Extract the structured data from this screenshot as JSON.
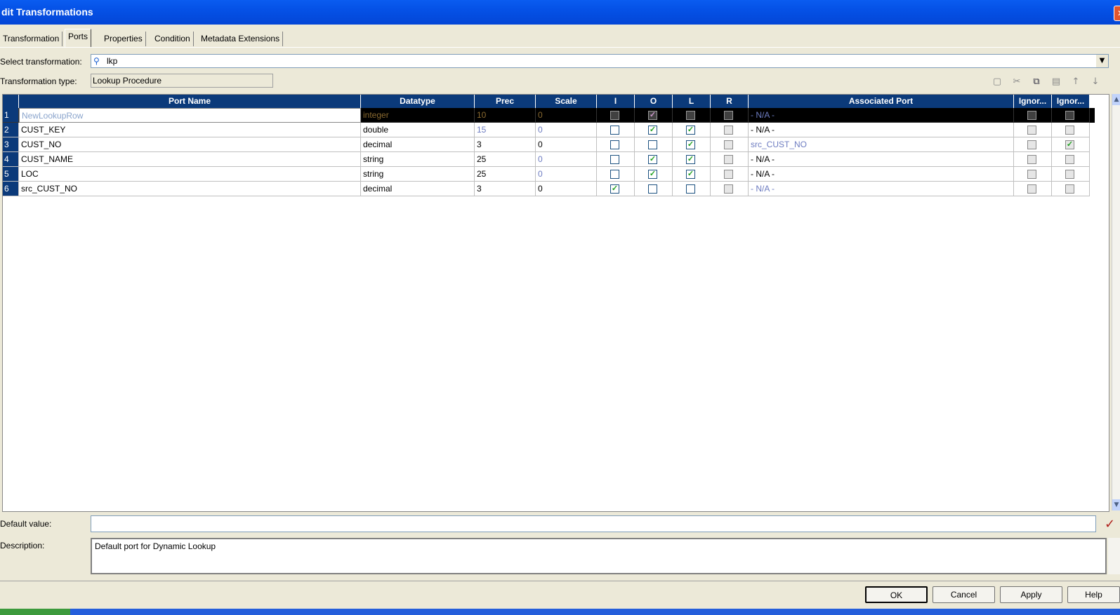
{
  "window": {
    "title": "dit Transformations",
    "close_glyph": "✕"
  },
  "tabs": [
    "Transformation",
    "Ports",
    "Properties",
    "Condition",
    "Metadata Extensions"
  ],
  "active_tab": "Ports",
  "select_transformation": {
    "label": "Select transformation:",
    "value": "lkp",
    "icon": "lookup-icon"
  },
  "transformation_type": {
    "label": "Transformation type:",
    "value": "Lookup Procedure"
  },
  "toolbar": {
    "icons": [
      "new-port-icon",
      "cut-icon",
      "copy-icon",
      "paste-icon",
      "move-up-icon",
      "move-down-icon"
    ],
    "glyphs": [
      "▢",
      "✂",
      "⧉",
      "▤",
      "↑",
      "↓"
    ]
  },
  "grid": {
    "columns": [
      "",
      "Port Name",
      "Datatype",
      "Prec",
      "Scale",
      "I",
      "O",
      "L",
      "R",
      "Associated Port",
      "Ignor...",
      "Ignor..."
    ],
    "rows": [
      {
        "num": "1",
        "name": "NewLookupRow",
        "datatype": "integer",
        "prec": "10",
        "scale": "0",
        "I": false,
        "O": true,
        "L": false,
        "R": false,
        "assoc": "- N/A -",
        "ig1": false,
        "ig2": false
      },
      {
        "num": "2",
        "name": "CUST_KEY",
        "datatype": "double",
        "prec": "15",
        "scale": "0",
        "I": false,
        "O": true,
        "L": true,
        "R": false,
        "assoc": "- N/A -",
        "ig1": false,
        "ig2": false
      },
      {
        "num": "3",
        "name": "CUST_NO",
        "datatype": "decimal",
        "prec": "3",
        "scale": "0",
        "I": false,
        "O": false,
        "L": true,
        "R": false,
        "assoc": "src_CUST_NO",
        "ig1": false,
        "ig2": true
      },
      {
        "num": "4",
        "name": "CUST_NAME",
        "datatype": "string",
        "prec": "25",
        "scale": "0",
        "I": false,
        "O": true,
        "L": true,
        "R": false,
        "assoc": "- N/A -",
        "ig1": false,
        "ig2": false
      },
      {
        "num": "5",
        "name": "LOC",
        "datatype": "string",
        "prec": "25",
        "scale": "0",
        "I": false,
        "O": true,
        "L": true,
        "R": false,
        "assoc": "- N/A -",
        "ig1": false,
        "ig2": false
      },
      {
        "num": "6",
        "name": "src_CUST_NO",
        "datatype": "decimal",
        "prec": "3",
        "scale": "0",
        "I": true,
        "O": false,
        "L": false,
        "R": false,
        "assoc": "- N/A -",
        "ig1": false,
        "ig2": false
      }
    ]
  },
  "default_value": {
    "label": "Default value:",
    "value": "",
    "validate_glyph": "✓"
  },
  "description": {
    "label": "Description:",
    "value": "Default port for Dynamic Lookup"
  },
  "buttons": {
    "ok": "OK",
    "cancel": "Cancel",
    "apply": "Apply",
    "help": "Help"
  }
}
